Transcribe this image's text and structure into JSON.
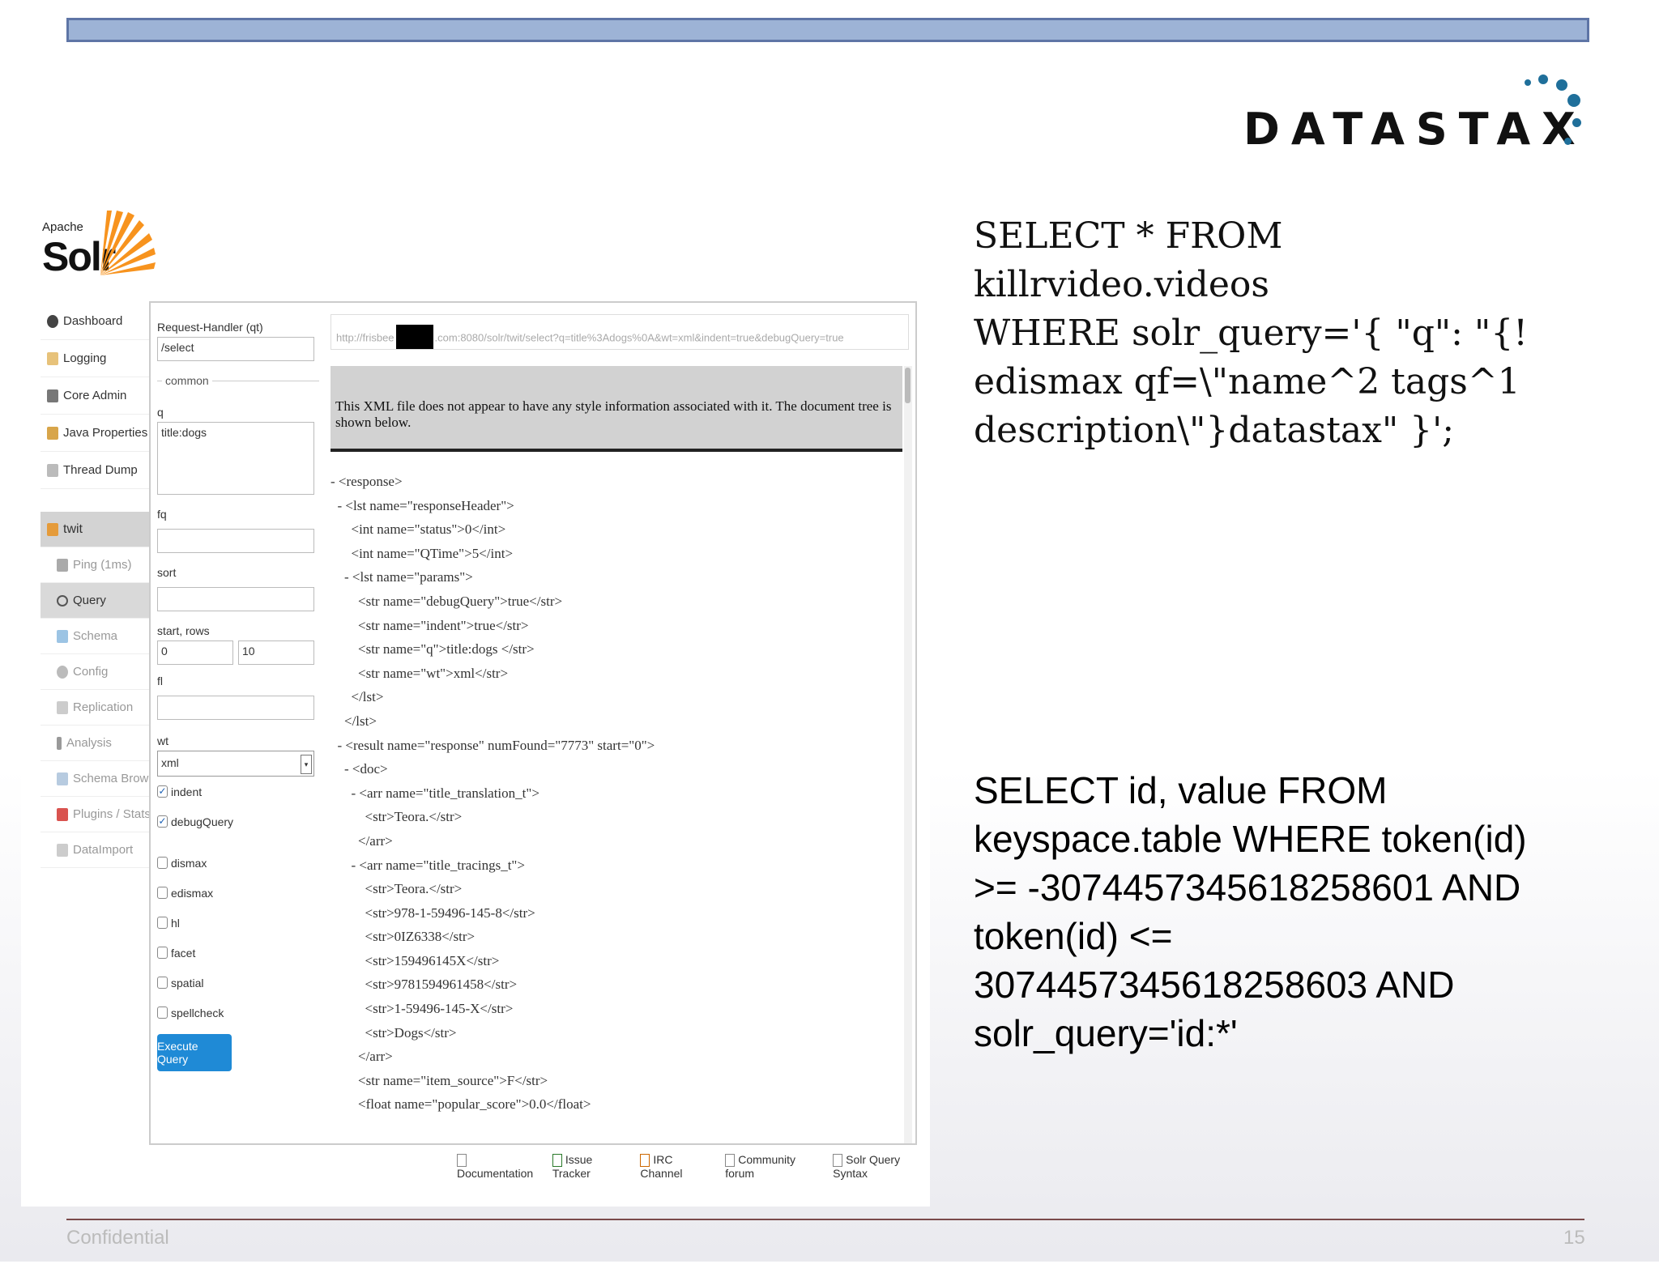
{
  "slide": {
    "logo": "DATASTAX",
    "sql1": "SELECT * FROM\nkillrvideo.videos\nWHERE solr_query='{ \"q\": \"{!\nedismax qf=\\\"name^2 tags^1\ndescription\\\"}datastax\" }';",
    "sql2": "SELECT id, value FROM\nkeyspace.table WHERE token(id)\n>= -3074457345618258601 AND\ntoken(id) <=\n3074457345618258603 AND\nsolr_query='id:*'",
    "footer_label": "Confidential",
    "page_number": "15"
  },
  "solr": {
    "apache": "Apache",
    "name": "Solr",
    "nav": [
      "Dashboard",
      "Logging",
      "Core Admin",
      "Java Properties",
      "Thread Dump"
    ],
    "core": "twit",
    "core_nav": [
      "Ping (1ms)",
      "Query",
      "Schema",
      "Config",
      "Replication",
      "Analysis",
      "Schema Browser",
      "Plugins / Stats",
      "DataImport"
    ],
    "form": {
      "handler_label": "Request-Handler (qt)",
      "handler_value": "/select",
      "common_label": "common",
      "q_label": "q",
      "q_value": "title:dogs",
      "fq_label": "fq",
      "sort_label": "sort",
      "start_rows_label": "start, rows",
      "start_value": "0",
      "rows_value": "10",
      "fl_label": "fl",
      "wt_label": "wt",
      "wt_value": "xml",
      "indent_label": "indent",
      "debug_label": "debugQuery",
      "options": [
        "dismax",
        "edismax",
        "hl",
        "facet",
        "spatial",
        "spellcheck"
      ],
      "execute": "Execute Query"
    },
    "url_prefix": "http://frisbee",
    "url_suffix": ".com:8080/solr/twit/select?q=title%3Adogs%0A&wt=xml&indent=true&debugQuery=true",
    "xml_notice": "This XML file does not appear to have any style information associated with it. The document tree is shown below.",
    "xml_lines": [
      "- <response>",
      "  - <lst name=\"responseHeader\">",
      "      <int name=\"status\">0</int>",
      "      <int name=\"QTime\">5</int>",
      "    - <lst name=\"params\">",
      "        <str name=\"debugQuery\">true</str>",
      "        <str name=\"indent\">true</str>",
      "        <str name=\"q\">title:dogs </str>",
      "        <str name=\"wt\">xml</str>",
      "      </lst>",
      "    </lst>",
      "  - <result name=\"response\" numFound=\"7773\" start=\"0\">",
      "    - <doc>",
      "      - <arr name=\"title_translation_t\">",
      "          <str>Teora.</str>",
      "        </arr>",
      "      - <arr name=\"title_tracings_t\">",
      "          <str>Teora.</str>",
      "          <str>978-1-59496-145-8</str>",
      "          <str>0IZ6338</str>",
      "          <str>159496145X</str>",
      "          <str>9781594961458</str>",
      "          <str>1-59496-145-X</str>",
      "          <str>Dogs</str>",
      "        </arr>",
      "        <str name=\"item_source\">F</str>",
      "        <float name=\"popular_score\">0.0</float>"
    ],
    "footer_links": [
      "Documentation",
      "Issue Tracker",
      "IRC Channel",
      "Community forum",
      "Solr Query Syntax"
    ]
  }
}
